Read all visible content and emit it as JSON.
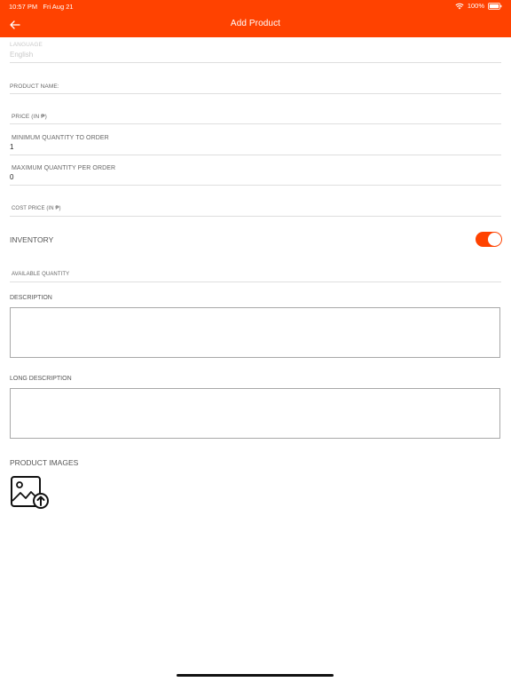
{
  "status_bar": {
    "time": "10:57 PM",
    "date": "Fri Aug 21",
    "battery": "100%"
  },
  "header": {
    "title": "Add Product",
    "back_icon": "arrow-left-icon",
    "color": "#ff4200"
  },
  "form": {
    "language": {
      "label": "LANGUAGE",
      "value": "English"
    },
    "product_name": {
      "label": "PRODUCT NAME:"
    },
    "price": {
      "label": "PRICE (IN ₱)"
    },
    "min_qty": {
      "label": "MINIMUM QUANTITY TO ORDER",
      "value": "1"
    },
    "max_qty": {
      "label": "MAXIMUM QUANTITY PER ORDER",
      "value": "0"
    },
    "cost_price": {
      "label": "COST PRICE (IN ₱)"
    },
    "inventory": {
      "label": "INVENTORY",
      "enabled": true
    },
    "available_qty": {
      "label": "AVAILABLE QUANTITY"
    },
    "description": {
      "label": "DESCRIPTION"
    },
    "long_description": {
      "label": "LONG DESCRIPTION"
    },
    "product_images": {
      "label": "PRODUCT IMAGES",
      "upload_icon": "image-upload-icon"
    }
  }
}
